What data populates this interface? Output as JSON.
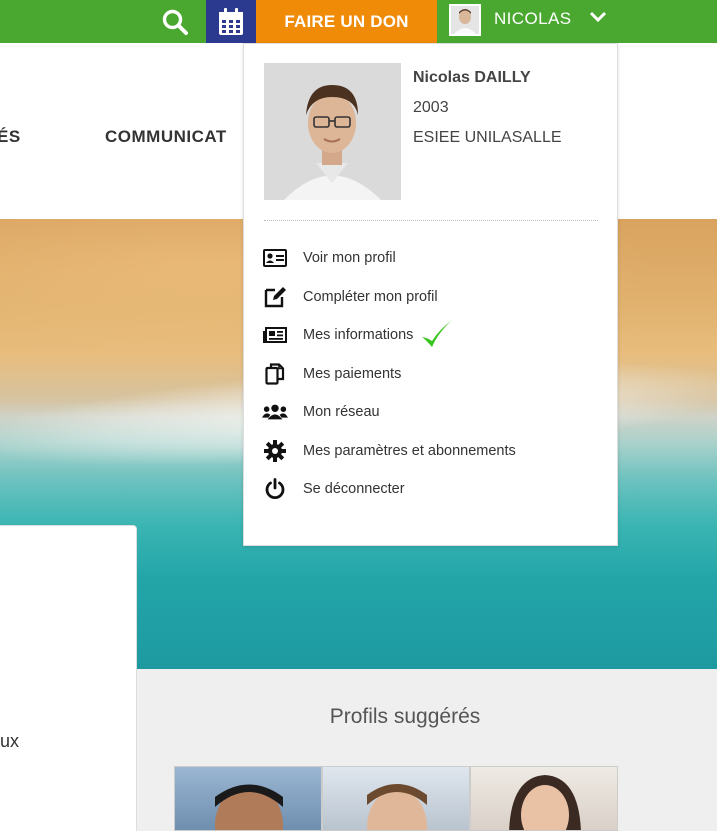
{
  "topbar": {
    "search_icon": "search-icon",
    "calendar_icon": "calendar-icon",
    "don_label": "FAIRE UN DON",
    "user_name": "NICOLAS",
    "chevron_icon": "chevron-down-icon",
    "colors": {
      "bar": "#4aa831",
      "calendar_bg": "#2b3a8e",
      "don_bg": "#ef8b07"
    }
  },
  "nav": {
    "items": [
      {
        "label": "ÉS"
      },
      {
        "label": "COMMUNICAT"
      }
    ]
  },
  "user_menu": {
    "name": "Nicolas DAILLY",
    "year": "2003",
    "school": "ESIEE UNILASALLE",
    "items": [
      {
        "label": "Voir mon profil",
        "icon": "id-card-icon"
      },
      {
        "label": "Compléter mon profil",
        "icon": "edit-icon"
      },
      {
        "label": "Mes informations",
        "icon": "newspaper-icon",
        "checked": true
      },
      {
        "label": "Mes paiements",
        "icon": "copy-icon"
      },
      {
        "label": "Mon réseau",
        "icon": "users-icon"
      },
      {
        "label": "Mes paramètres et abonnements",
        "icon": "gear-icon"
      },
      {
        "label": "Se déconnecter",
        "icon": "power-icon"
      }
    ]
  },
  "content": {
    "left_card_text": "ux",
    "suggested_title": "Profils suggérés"
  }
}
